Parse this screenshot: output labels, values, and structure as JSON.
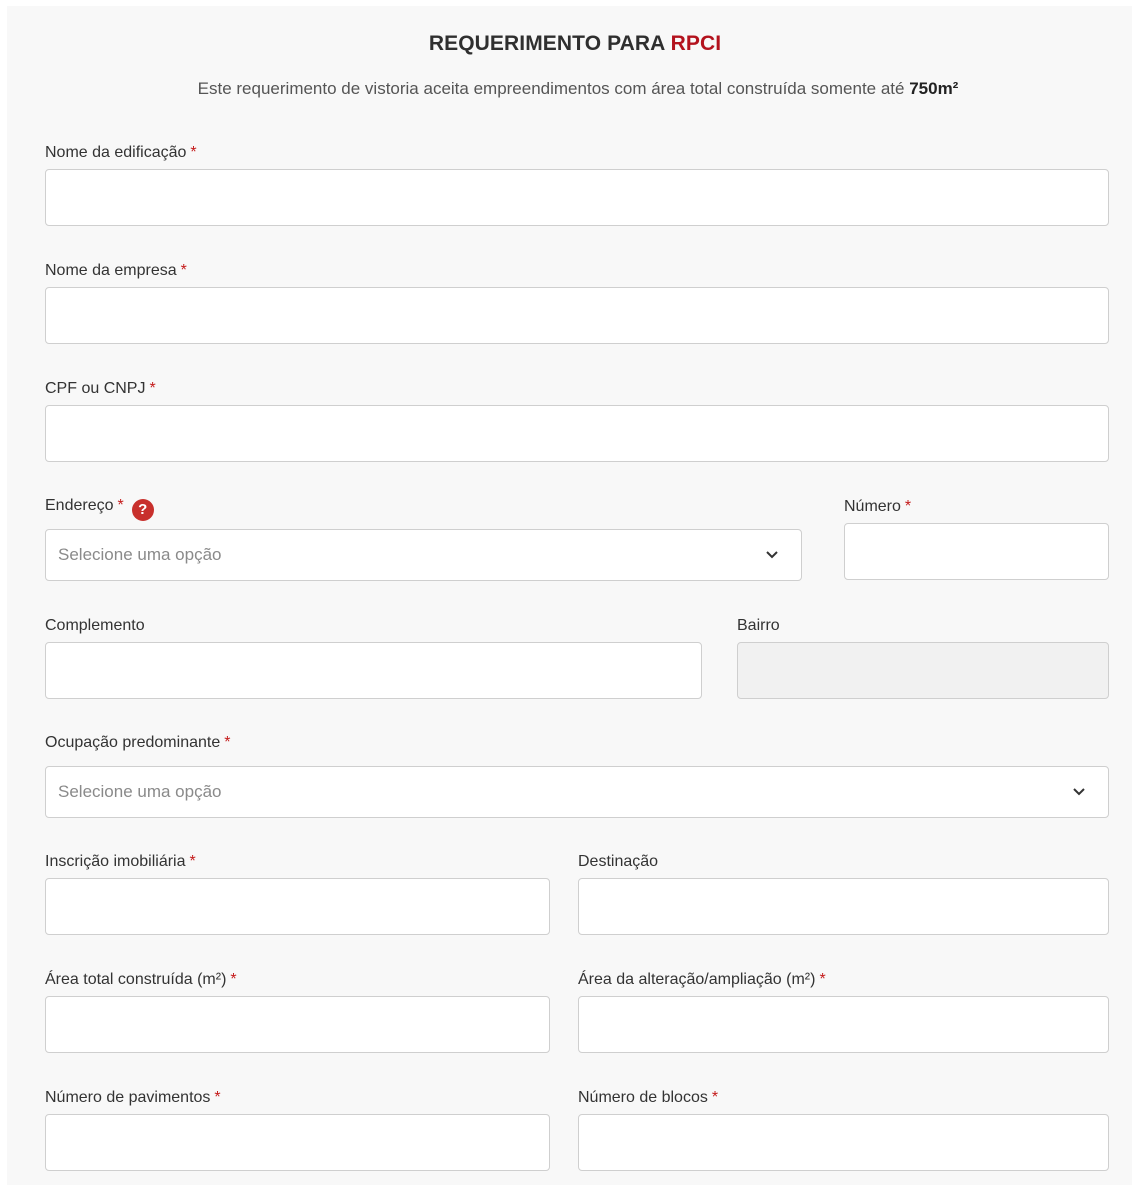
{
  "header": {
    "title_prefix": "REQUERIMENTO PARA ",
    "title_accent": "RPCI",
    "subtitle_text": "Este requerimento de vistoria aceita empreendimentos com área total construída somente até ",
    "subtitle_bold": "750m²"
  },
  "required_marker": "*",
  "fields": {
    "nome_edificacao": {
      "label": "Nome da edificação",
      "value": ""
    },
    "nome_empresa": {
      "label": "Nome da empresa",
      "value": ""
    },
    "cpf_cnpj": {
      "label": "CPF ou CNPJ",
      "value": ""
    },
    "endereco": {
      "label": "Endereço",
      "placeholder": "Selecione uma opção",
      "help_icon": "question-icon",
      "help_glyph": "?"
    },
    "numero": {
      "label": "Número",
      "value": ""
    },
    "complemento": {
      "label": "Complemento",
      "value": ""
    },
    "bairro": {
      "label": "Bairro",
      "value": ""
    },
    "ocupacao": {
      "label": "Ocupação predominante",
      "placeholder": "Selecione uma opção"
    },
    "inscricao": {
      "label": "Inscrição imobiliária",
      "value": ""
    },
    "destinacao": {
      "label": "Destinação",
      "value": ""
    },
    "area_total": {
      "label": "Área total construída (m²)",
      "value": ""
    },
    "area_alteracao": {
      "label": "Área da alteração/ampliação (m²)",
      "value": ""
    },
    "num_pavimentos": {
      "label": "Número de pavimentos",
      "value": ""
    },
    "num_blocos": {
      "label": "Número de blocos",
      "value": ""
    }
  },
  "colors": {
    "accent": "#b3121d",
    "required": "#c41a1a",
    "help_icon": "#c8302c",
    "panel_background": "#f8f8f8"
  }
}
